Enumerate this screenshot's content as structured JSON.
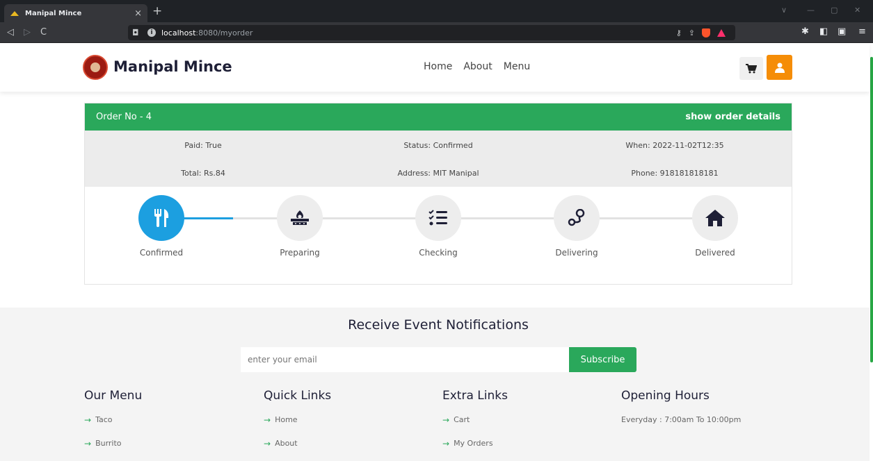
{
  "browser": {
    "tab_title": "Manipal Mince",
    "tab_close": "×",
    "new_tab": "+",
    "url_host": "localhost",
    "url_rest": ":8080/myorder",
    "win_min": "—",
    "win_max": "▢",
    "win_close": "✕",
    "win_down": "∨"
  },
  "header": {
    "brand": "Manipal Mince",
    "nav": [
      "Home",
      "About",
      "Menu"
    ]
  },
  "order": {
    "title": "Order No - 4",
    "details_link": "show order details",
    "paid": "Paid: True",
    "status": "Status: Confirmed",
    "when": "When: 2022-11-02T12:35",
    "total": "Total: Rs.84",
    "address": "Address: MIT Manipal",
    "phone": "Phone: 918181818181",
    "steps": [
      {
        "label": "Confirmed",
        "icon": "utensils-icon",
        "active": true
      },
      {
        "label": "Preparing",
        "icon": "stove-icon",
        "active": false
      },
      {
        "label": "Checking",
        "icon": "checklist-icon",
        "active": false
      },
      {
        "label": "Delivering",
        "icon": "route-icon",
        "active": false
      },
      {
        "label": "Delivered",
        "icon": "home-icon",
        "active": false
      }
    ],
    "progress_fraction": 0.13
  },
  "footer": {
    "notif_title": "Receive Event Notifications",
    "email_placeholder": "enter your email",
    "subscribe": "Subscribe",
    "columns": [
      {
        "title": "Our Menu",
        "links": [
          "Taco",
          "Burrito"
        ]
      },
      {
        "title": "Quick Links",
        "links": [
          "Home",
          "About"
        ]
      },
      {
        "title": "Extra Links",
        "links": [
          "Cart",
          "My Orders"
        ]
      }
    ],
    "hours_title": "Opening Hours",
    "hours_text": "Everyday : 7:00am To 10:00pm",
    "arrow": "→"
  },
  "colors": {
    "accent_green": "#2aa85b",
    "step_blue": "#1c9fe0",
    "user_orange": "#f58d07"
  }
}
